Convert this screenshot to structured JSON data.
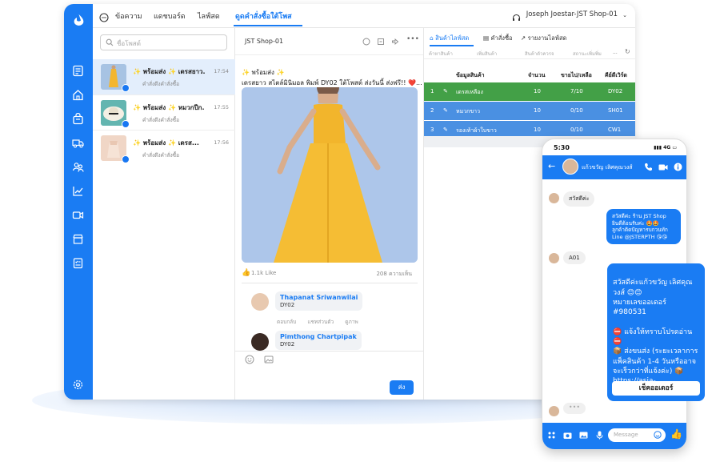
{
  "topbar": {
    "tabs": [
      "ข้อความ",
      "แดชบอร์ด",
      "ไลฟ์สด",
      "ดูดคำสั่งซื้อใต้โพส"
    ],
    "active_tab": "ดูดคำสั่งซื้อใต้โพส",
    "user": "Joseph Joestar-JST Shop-01"
  },
  "conversations": {
    "search_placeholder": "ชื่อโพสต์",
    "items": [
      {
        "title": "✨ พร้อมส่ง ✨ เดรสยาว...",
        "sub": "คำสั่งดึงคำสั่งซื้อ",
        "time": "17:54"
      },
      {
        "title": "✨ พร้อมส่ง ✨ หมวกปีก...",
        "sub": "คำสั่งดึงคำสั่งซื้อ",
        "time": "17:55"
      },
      {
        "title": "✨ พร้อมส่ง ✨ เดรส...",
        "sub": "คำสั่งดึงคำสั่งซื้อ",
        "time": "17:56"
      }
    ]
  },
  "post": {
    "page_name": "JST Shop-01",
    "caption_line1": "✨ พร้อมส่ง ✨",
    "caption_line2": "เดรสยาว สไตล์มินิมอล พิมพ์ DY02 ใต้โพสต์ ส่งวันนี้ ส่งฟรี!! ❤️...",
    "likes": "1.1k Like",
    "comments_count": "208 ความเห็น",
    "comments": [
      {
        "name": "Thapanat Sriwanwilai",
        "text": "DY02",
        "actions": [
          "ตอบกลับ",
          "แชทส่วนตัว",
          "ดูภาพ"
        ]
      },
      {
        "name": "Pimthong Chartpipak",
        "text": "DY02"
      }
    ],
    "send_label": "ส่ง"
  },
  "product": {
    "tabs": [
      "สินค้าไลฟ์สด",
      "คำสั่งซื้อ",
      "รายงานไลฟ์สด"
    ],
    "filters": [
      "ค้าหาสินค้า",
      "เพิ่มสินค้า",
      "สินค้าตัวควรจ",
      "สถานะเพิ่มพิ่ม",
      "..."
    ],
    "headers": [
      "ข้อมูลสินค้า",
      "จำนวน",
      "ขายไป/เหลือ",
      "คีย์ดีเวิร์ด"
    ],
    "rows": [
      {
        "no": "1",
        "name": "เดรสเหลือง",
        "qty": "10",
        "sold": "7/10",
        "key": "DY02",
        "color": "#43a047"
      },
      {
        "no": "2",
        "name": "หมวกขาว",
        "qty": "10",
        "sold": "0/10",
        "key": "SH01",
        "color": "#4a90e2"
      },
      {
        "no": "3",
        "name": "รองเท้าผ้าใบขาว",
        "qty": "10",
        "sold": "0/10",
        "key": "CW1",
        "color": "#4a90e2"
      }
    ]
  },
  "phone": {
    "time": "5:30",
    "signal": "4G",
    "contact_name": "แก้วขวัญ เลิศคุณวงส์",
    "messages": {
      "in1": "สวัสดีค่ะ",
      "out1": "สวัสดีค่ะ ร้าน JST Shop\nยินดีต้อนรับค่ะ 🤩🤩\nลูกค้าติดปัญหารบกวนทัก\nLine @JSTERPTH 😘😘",
      "in2": "A01",
      "big": "สวัสดีค่ะแก้วขวัญ เลิศคุณ\nวงส์  😊😊\nหมายเลขออเดอร์\n#980531\n\n⛔ แจ้งให้ทราบโปรดอ่าน ⛔\n📦 ส่งขนส่ง (ระยะเวลาการ\nแพ็คสินค้า 1-4 วันหรืออาจ\nจะเร็วกว่าที่แจ้งค่ะ) 📦\nhttps://asia-Web.jsterp...",
      "checkout": "เช็คออเดอร์"
    },
    "input_placeholder": "Message"
  }
}
